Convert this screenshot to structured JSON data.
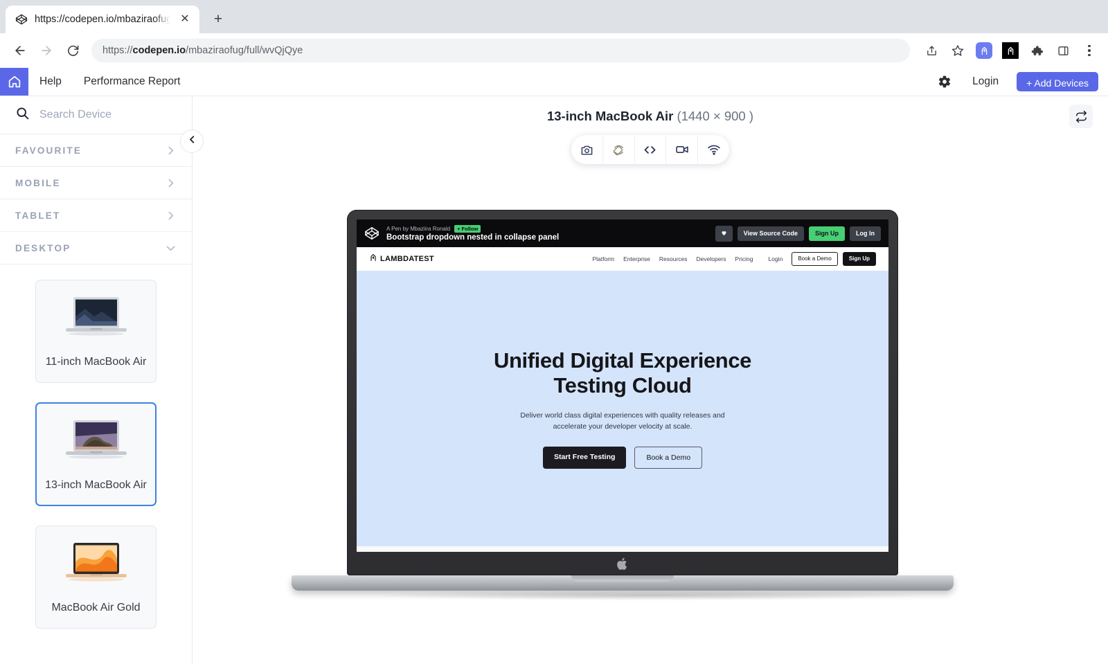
{
  "browser": {
    "tab": {
      "title": "https://codepen.io/mbaziraofug",
      "favicon_icon": "codepen-icon",
      "close_icon": "close-icon"
    },
    "new_tab_icon": "plus-icon",
    "back_icon": "arrow-left-icon",
    "forward_icon": "arrow-right-icon",
    "reload_icon": "reload-icon",
    "url_prefix": "https://",
    "url_domain": "codepen.io",
    "url_path": "/mbaziraofug/full/wvQjQye",
    "actions": [
      "share-icon",
      "bookmark-star-icon",
      "extension-lambdatest-icon",
      "extension-lambdatest-dark-icon",
      "extensions-puzzle-icon",
      "side-panel-icon",
      "chrome-menu-icon"
    ]
  },
  "app_header": {
    "home_icon": "home-icon",
    "links": [
      "Help",
      "Performance Report"
    ],
    "gear_icon": "gear-icon",
    "login_label": "Login",
    "add_devices_label": "+ Add Devices",
    "accent_color": "#5a68e8"
  },
  "sidebar": {
    "search": {
      "placeholder": "Search Device",
      "value": "",
      "icon": "search-icon"
    },
    "categories": [
      {
        "label": "FAVOURITE",
        "expanded": false,
        "chevron": "chevron-right-icon"
      },
      {
        "label": "MOBILE",
        "expanded": false,
        "chevron": "chevron-right-icon"
      },
      {
        "label": "TABLET",
        "expanded": false,
        "chevron": "chevron-right-icon"
      },
      {
        "label": "DESKTOP",
        "expanded": true,
        "chevron": "chevron-down-icon"
      }
    ],
    "devices": [
      {
        "name": "11-inch MacBook Air",
        "selected": false,
        "wallpaper": "mojave-night"
      },
      {
        "name": "13-inch MacBook Air",
        "selected": true,
        "wallpaper": "catalina-island"
      },
      {
        "name": "MacBook Air Gold",
        "selected": false,
        "wallpaper": "bigsur-orange"
      }
    ],
    "collapse_icon": "chevron-left-icon",
    "selected_border_color": "#3b82e0"
  },
  "main": {
    "device_title": "13-inch MacBook Air",
    "device_resolution": "(1440 × 900 )",
    "refresh_icon": "refresh-sync-icon",
    "toolbar_icons": [
      "camera-icon",
      "screen-rotate-icon",
      "code-brackets-icon",
      "video-camera-icon",
      "wifi-icon"
    ]
  },
  "codepen_header": {
    "logo_icon": "codepen-icon",
    "byline": "A Pen by Mbaziira Ronald",
    "follow_label": "+ Follow",
    "pen_title": "Bootstrap dropdown nested in collapse panel",
    "heart_icon": "heart-icon",
    "view_source_label": "View Source Code",
    "sign_up_label": "Sign Up",
    "log_in_label": "Log In",
    "sign_up_color": "#47cf73"
  },
  "page": {
    "brand": {
      "icon": "lambdatest-logo-icon",
      "text": "LAMBDATEST"
    },
    "nav_links": [
      "Platform",
      "Enterprise",
      "Resources",
      "Developers",
      "Pricing"
    ],
    "login_label": "Login",
    "book_demo_label": "Book a Demo",
    "sign_up_label": "Sign Up",
    "hero": {
      "heading": "Unified Digital Experience Testing Cloud",
      "subheading": "Deliver world class digital experiences with quality releases and accelerate your developer velocity at scale.",
      "cta_primary": "Start Free Testing",
      "cta_secondary": "Book a Demo",
      "background_color": "#d4e4fb"
    }
  }
}
